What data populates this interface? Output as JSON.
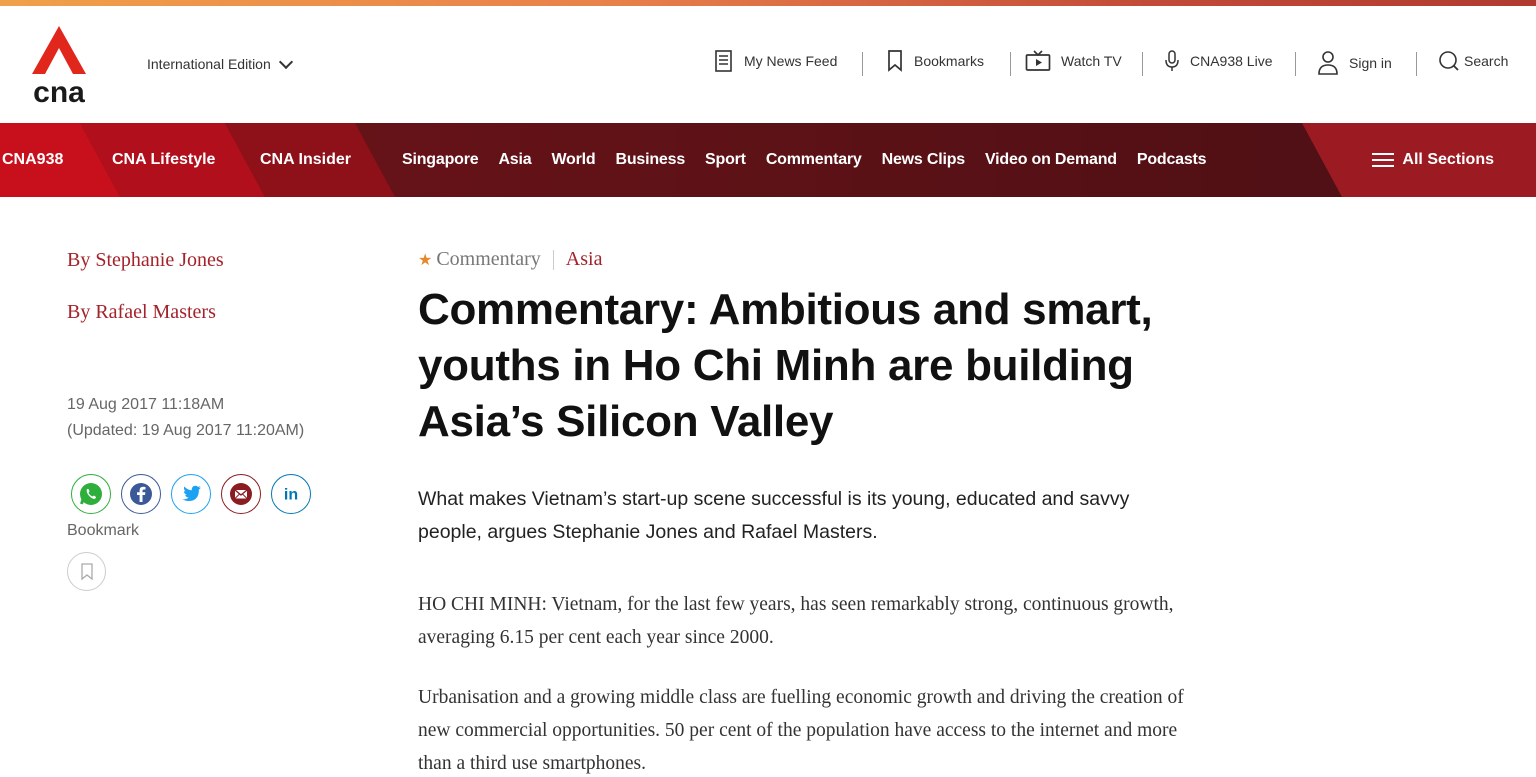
{
  "header": {
    "edition_label": "International Edition",
    "utilities": {
      "news_feed": "My News Feed",
      "bookmarks": "Bookmarks",
      "watch_tv": "Watch TV",
      "radio_live": "CNA938 Live",
      "sign_in": "Sign in",
      "search": "Search"
    }
  },
  "nav": {
    "sub_brands": [
      "CNA938",
      "CNA Lifestyle",
      "CNA Insider"
    ],
    "sections": [
      "Singapore",
      "Asia",
      "World",
      "Business",
      "Sport",
      "Commentary",
      "News Clips",
      "Video on Demand",
      "Podcasts"
    ],
    "all_sections": "All Sections"
  },
  "sidebar": {
    "authors": [
      "By Stephanie Jones",
      "By Rafael Masters"
    ],
    "published": "19 Aug 2017 11:18AM",
    "updated": "(Updated: 19 Aug 2017 11:20AM)",
    "bookmark_label": "Bookmark",
    "share_icons": [
      "whatsapp-icon",
      "facebook-icon",
      "twitter-icon",
      "email-icon",
      "linkedin-icon"
    ]
  },
  "article": {
    "category": "Commentary",
    "region": "Asia",
    "headline": "Commentary: Ambitious and smart, youths in Ho Chi Minh are building Asia’s Silicon Valley",
    "standfirst": "What makes Vietnam’s start-up scene successful is its young, educated and savvy people, argues Stephanie Jones and Rafael Masters.",
    "paragraphs": [
      "HO CHI MINH: Vietnam, for the last few years, has seen remarkably strong, continuous growth, averaging 6.15 per cent each year since 2000.",
      "Urbanisation and a growing middle class are fuelling economic growth and driving the creation of new commercial opportunities. 50 per cent of the population have access to the internet and more than a third use smartphones."
    ]
  },
  "colors": {
    "brand_red": "#d0021b",
    "nav_dark": "#5a1218",
    "author_red": "#a3232b",
    "star_orange": "#e58a2c"
  }
}
